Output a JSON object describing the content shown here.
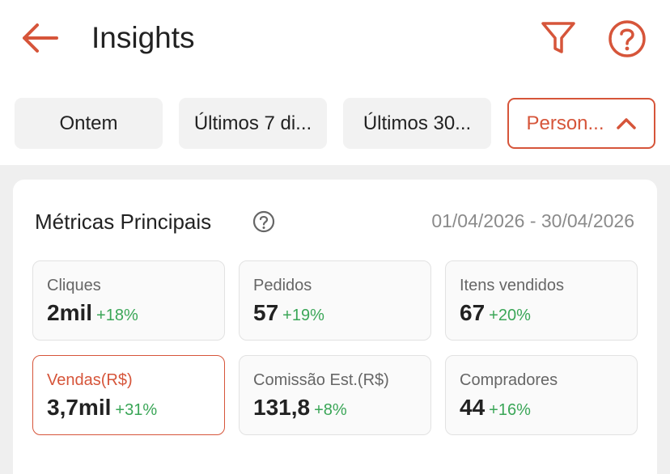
{
  "header": {
    "title": "Insights",
    "back_icon": "arrow-left-icon",
    "filter_icon": "funnel-icon",
    "help_icon": "question-circle-icon"
  },
  "period_chips": [
    {
      "label": "Ontem",
      "selected": false
    },
    {
      "label": "Últimos 7 di...",
      "selected": false
    },
    {
      "label": "Últimos 30...",
      "selected": false
    },
    {
      "label": "Person...",
      "selected": true
    }
  ],
  "metrics_card": {
    "title": "Métricas Principais",
    "date_range": "01/04/2026 - 30/04/2026",
    "items": [
      {
        "label": "Cliques",
        "value": "2mil",
        "delta": "+18%"
      },
      {
        "label": "Pedidos",
        "value": "57",
        "delta": "+19%"
      },
      {
        "label": "Itens vendidos",
        "value": "67",
        "delta": "+20%"
      },
      {
        "label": "Vendas(R$)",
        "value": "3,7mil",
        "delta": "+31%",
        "selected": true
      },
      {
        "label": "Comissão Est.(R$)",
        "value": "131,8",
        "delta": "+8%"
      },
      {
        "label": "Compradores",
        "value": "44",
        "delta": "+16%"
      }
    ]
  },
  "colors": {
    "accent": "#d6553a",
    "positive": "#3aa657",
    "muted_text": "#8b8b8b",
    "background": "#efefef"
  }
}
